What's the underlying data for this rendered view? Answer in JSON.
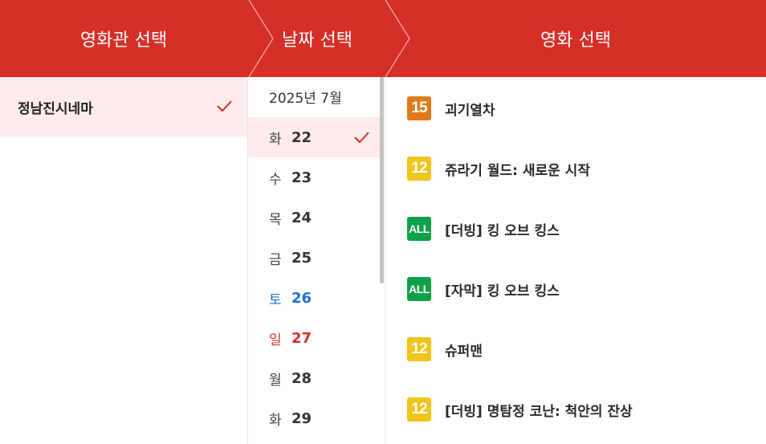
{
  "header": {
    "theater_step": "영화관 선택",
    "date_step": "날짜 선택",
    "movie_step": "영화 선택",
    "bg_color": "#d62f28"
  },
  "theaters": [
    {
      "label": "정남진시네마",
      "selected": true
    }
  ],
  "date": {
    "month_label": "2025년 7월",
    "days": [
      {
        "dow": "화",
        "day": "22",
        "kind": "weekday",
        "selected": true
      },
      {
        "dow": "수",
        "day": "23",
        "kind": "weekday",
        "selected": false
      },
      {
        "dow": "목",
        "day": "24",
        "kind": "weekday",
        "selected": false
      },
      {
        "dow": "금",
        "day": "25",
        "kind": "weekday",
        "selected": false
      },
      {
        "dow": "토",
        "day": "26",
        "kind": "sat",
        "selected": false
      },
      {
        "dow": "일",
        "day": "27",
        "kind": "sun",
        "selected": false
      },
      {
        "dow": "월",
        "day": "28",
        "kind": "weekday",
        "selected": false
      },
      {
        "dow": "화",
        "day": "29",
        "kind": "weekday",
        "selected": false
      }
    ]
  },
  "movies": [
    {
      "rating": "15",
      "rating_color": "#e07a1d",
      "title": "괴기열차"
    },
    {
      "rating": "12",
      "rating_color": "#f0c419",
      "title": "쥬라기 월드: 새로운 시작"
    },
    {
      "rating": "ALL",
      "rating_color": "#10a04a",
      "title": "[더빙] 킹 오브 킹스"
    },
    {
      "rating": "ALL",
      "rating_color": "#10a04a",
      "title": "[자막] 킹 오브 킹스"
    },
    {
      "rating": "12",
      "rating_color": "#f0c419",
      "title": "슈퍼맨"
    },
    {
      "rating": "12",
      "rating_color": "#f0c419",
      "title": "[더빙] 명탐정 코난: 척안의 잔상"
    }
  ],
  "icons": {
    "check": "check-icon",
    "step_arrow": "chevron-right-icon"
  }
}
